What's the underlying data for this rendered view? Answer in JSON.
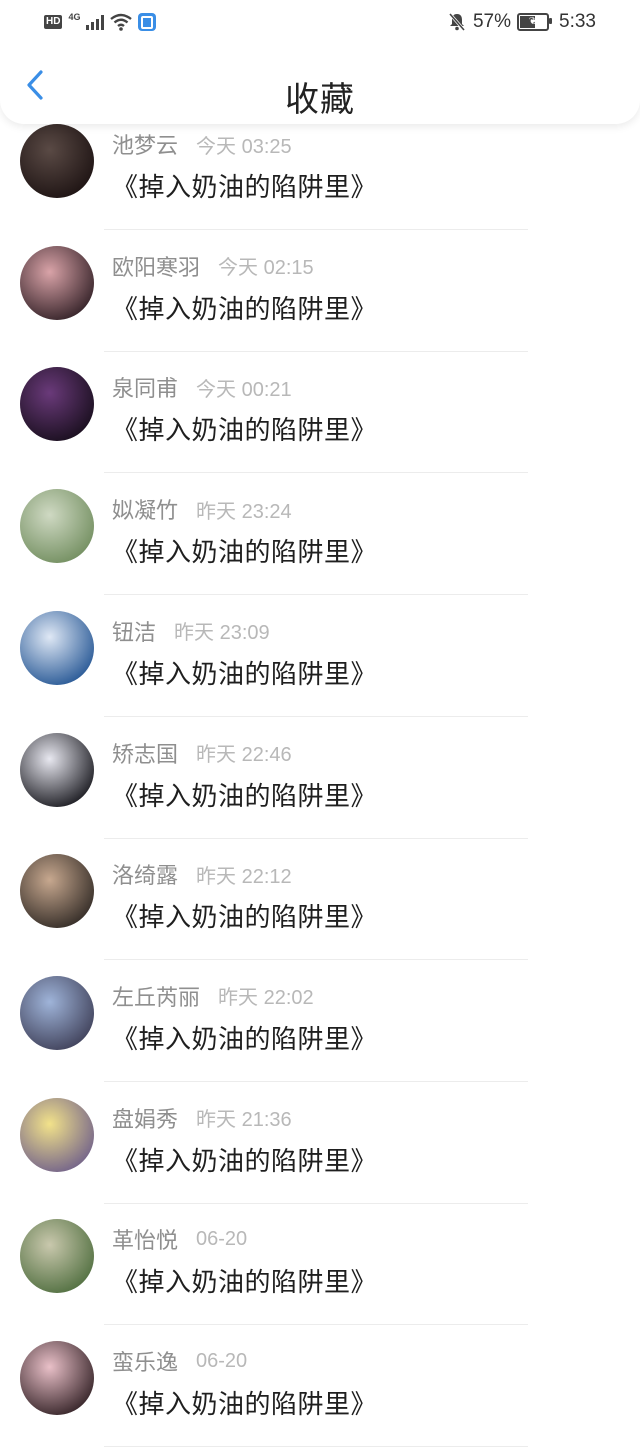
{
  "status_bar": {
    "hd": "HD",
    "network": "4G",
    "battery_percent": "57%",
    "clock": "5:33"
  },
  "header": {
    "title": "收藏"
  },
  "items": [
    {
      "name": "池梦云",
      "time": "今天 03:25",
      "book": "《掉入奶油的陷阱里》",
      "avatar": [
        "#5a4a45",
        "#1a1010"
      ]
    },
    {
      "name": "欧阳寒羽",
      "time": "今天 02:15",
      "book": "《掉入奶油的陷阱里》",
      "avatar": [
        "#d9a3a8",
        "#2a1a20"
      ]
    },
    {
      "name": "泉同甫",
      "time": "今天 00:21",
      "book": "《掉入奶油的陷阱里》",
      "avatar": [
        "#6a3a7a",
        "#140c18"
      ]
    },
    {
      "name": "姒凝竹",
      "time": "昨天 23:24",
      "book": "《掉入奶油的陷阱里》",
      "avatar": [
        "#cfd9c3",
        "#6d8a5a"
      ]
    },
    {
      "name": "钮洁",
      "time": "昨天 23:09",
      "book": "《掉入奶油的陷阱里》",
      "avatar": [
        "#dfe8f5",
        "#1c4f8f"
      ]
    },
    {
      "name": "矫志国",
      "time": "昨天 22:46",
      "book": "《掉入奶油的陷阱里》",
      "avatar": [
        "#e8e8f0",
        "#0e0e14"
      ]
    },
    {
      "name": "洛绮露",
      "time": "昨天 22:12",
      "book": "《掉入奶油的陷阱里》",
      "avatar": [
        "#c7a88f",
        "#2a2420"
      ]
    },
    {
      "name": "左丘芮丽",
      "time": "昨天 22:02",
      "book": "《掉入奶油的陷阱里》",
      "avatar": [
        "#9fb4d9",
        "#3a3a52"
      ]
    },
    {
      "name": "盘娟秀",
      "time": "昨天 21:36",
      "book": "《掉入奶油的陷阱里》",
      "avatar": [
        "#f2e28a",
        "#6a5a8a"
      ]
    },
    {
      "name": "革怡悦",
      "time": "06-20",
      "book": "《掉入奶油的陷阱里》",
      "avatar": [
        "#c9c8ad",
        "#4a6a3a"
      ]
    },
    {
      "name": "蛮乐逸",
      "time": "06-20",
      "book": "《掉入奶油的陷阱里》",
      "avatar": [
        "#e9c0c8",
        "#2a1a1e"
      ]
    }
  ],
  "colors": {
    "back_arrow": "#3a8ee6",
    "name_text": "#8f8f8f",
    "time_text": "#b8b8b8",
    "book_text": "#1f1f1f"
  }
}
